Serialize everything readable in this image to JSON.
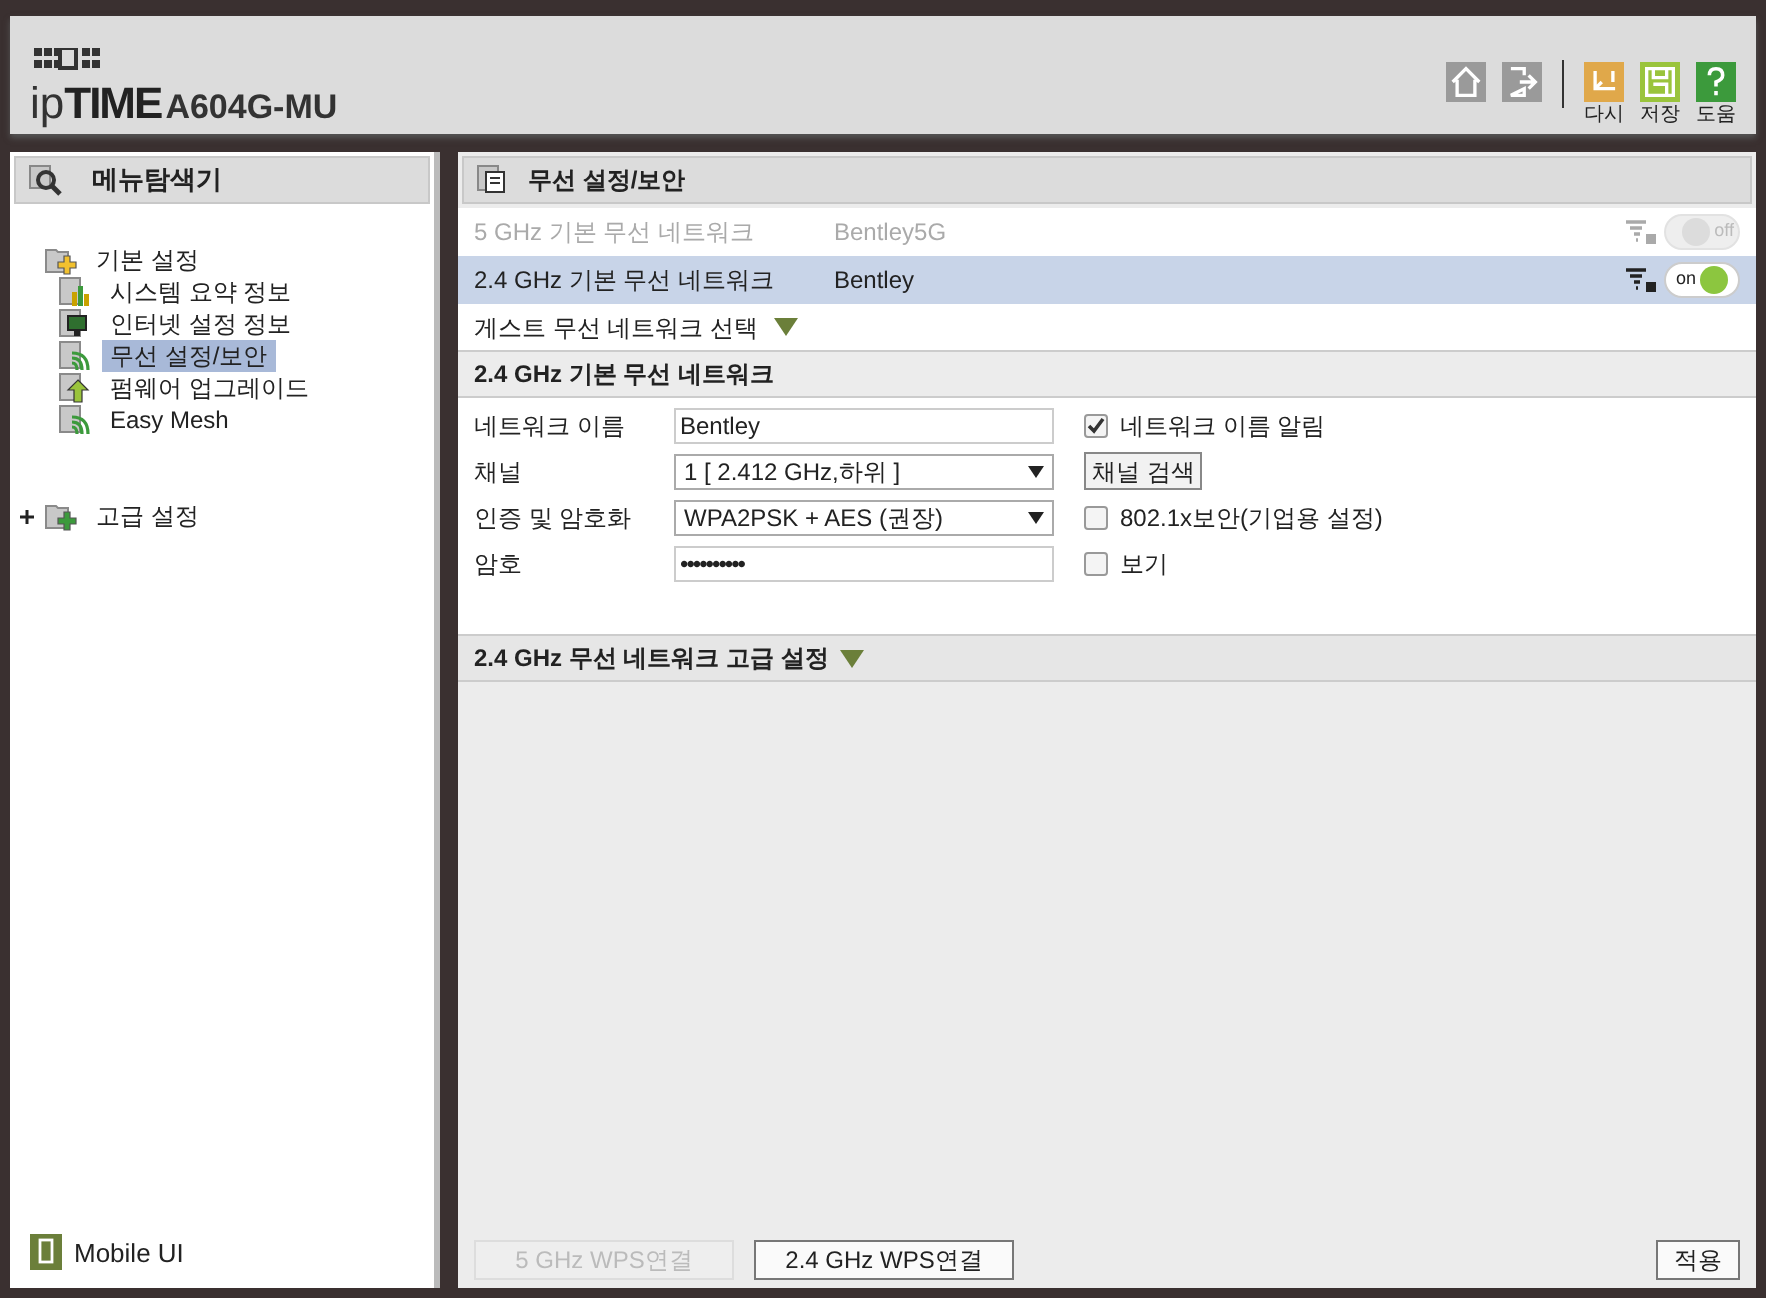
{
  "header": {
    "logo_prefix": "ip",
    "logo_brand": "TIME",
    "model": "A604G-MU",
    "actions": [
      {
        "kind": "home"
      },
      {
        "kind": "logout"
      },
      {
        "kind": "undo",
        "label": "다시"
      },
      {
        "kind": "save",
        "label": "저장"
      },
      {
        "kind": "help",
        "label": "도움"
      }
    ]
  },
  "sidebar": {
    "title": "메뉴탐색기",
    "tree": [
      {
        "label": "기본 설정",
        "kind": "folder",
        "expanded": true,
        "children": [
          {
            "label": "시스템 요약 정보",
            "kind": "chart",
            "selected": false
          },
          {
            "label": "인터넷 설정 정보",
            "kind": "monitor",
            "selected": false
          },
          {
            "label": "무선 설정/보안",
            "kind": "wifi",
            "selected": true
          },
          {
            "label": "펌웨어 업그레이드",
            "kind": "upgrade",
            "selected": false
          },
          {
            "label": "Easy Mesh",
            "kind": "wifi",
            "selected": false
          }
        ]
      },
      {
        "label": "고급 설정",
        "kind": "folder-plus",
        "expanded": false
      }
    ],
    "mobile": "Mobile UI"
  },
  "main": {
    "title": "무선 설정/보안",
    "networks": [
      {
        "name": "5 GHz 기본 무선 네트워크",
        "ssid": "Bentley5G",
        "on": false,
        "selected": false,
        "toggle": "off"
      },
      {
        "name": "2.4 GHz 기본 무선 네트워크",
        "ssid": "Bentley",
        "on": true,
        "selected": true,
        "toggle": "on"
      }
    ],
    "guest": "게스트 무선 네트워크 선택",
    "section": "2.4 GHz 기본 무선 네트워크",
    "rows": [
      {
        "label": "네트워크 이름",
        "kind": "text",
        "value": "Bentley",
        "extra": {
          "kind": "checkbox",
          "label": "네트워크 이름 알림",
          "checked": true
        }
      },
      {
        "label": "채널",
        "kind": "select",
        "value": "1 [ 2.412 GHz,하위 ]",
        "extra": {
          "kind": "button",
          "label": "채널 검색"
        }
      },
      {
        "label": "인증 및 암호화",
        "kind": "select",
        "value": "WPA2PSK + AES (권장)",
        "extra": {
          "kind": "checkbox",
          "label": "802.1x보안(기업용 설정)",
          "checked": false
        }
      },
      {
        "label": "암호",
        "kind": "password",
        "value": "••••••••••",
        "extra": {
          "kind": "checkbox",
          "label": "보기",
          "checked": false
        }
      }
    ],
    "advanced": "2.4 GHz 무선 네트워크 고급 설정",
    "buttons": [
      {
        "label": "5 GHz WPS연결",
        "disabled": true
      },
      {
        "label": "2.4 GHz WPS연결",
        "disabled": false
      }
    ],
    "apply": "적용"
  }
}
